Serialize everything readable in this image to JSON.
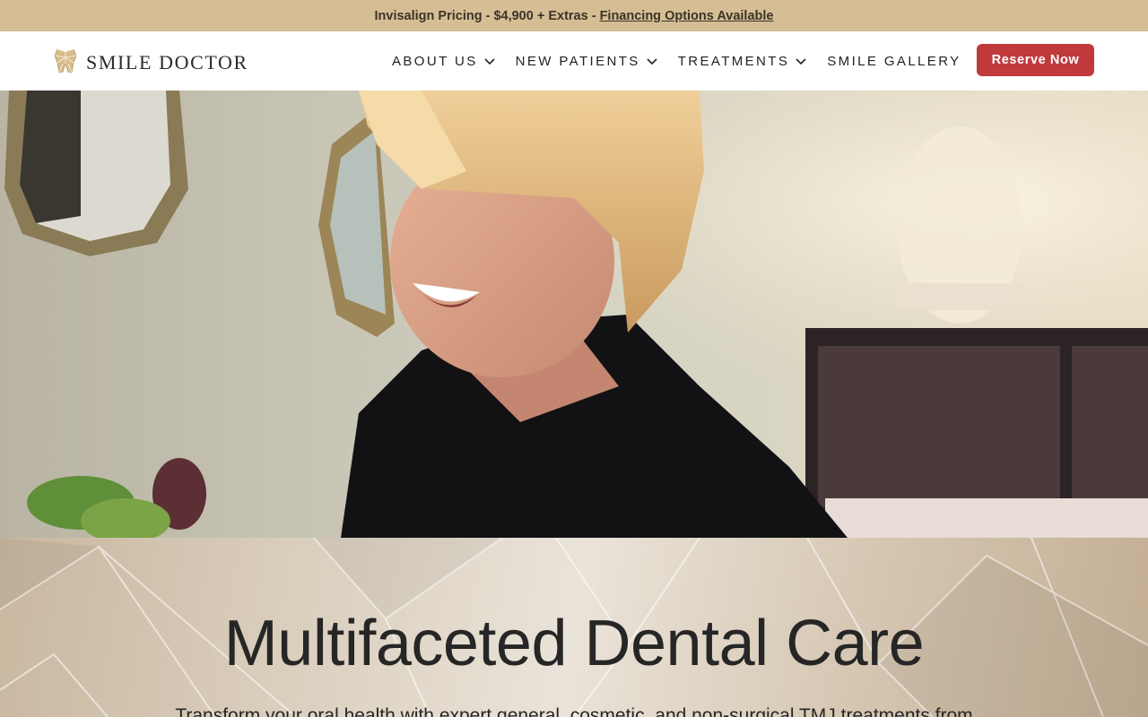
{
  "announcement": {
    "pricing_text": "Invisalign Pricing - $4,900 + Extras -",
    "link_text": "Financing Options Available"
  },
  "header": {
    "logo_text": "SMILE DOCTOR",
    "logo_icon": "tooth-icon",
    "nav": [
      {
        "label": "ABOUT US",
        "has_dropdown": true
      },
      {
        "label": "NEW PATIENTS",
        "has_dropdown": true
      },
      {
        "label": "TREATMENTS",
        "has_dropdown": true
      },
      {
        "label": "SMILE GALLERY",
        "has_dropdown": false
      }
    ],
    "cta_label": "Reserve Now"
  },
  "hero": {
    "image_alt": "Smiling woman with short blonde hair in a dental office"
  },
  "section": {
    "heading": "Multifaceted Dental Care",
    "intro": "Transform your oral health with expert general, cosmetic, and non-surgical TMJ treatments from"
  },
  "colors": {
    "announcement_bg": "#d6be94",
    "cta_bg": "#c0393b",
    "logo_gold": "#c9a86a"
  }
}
